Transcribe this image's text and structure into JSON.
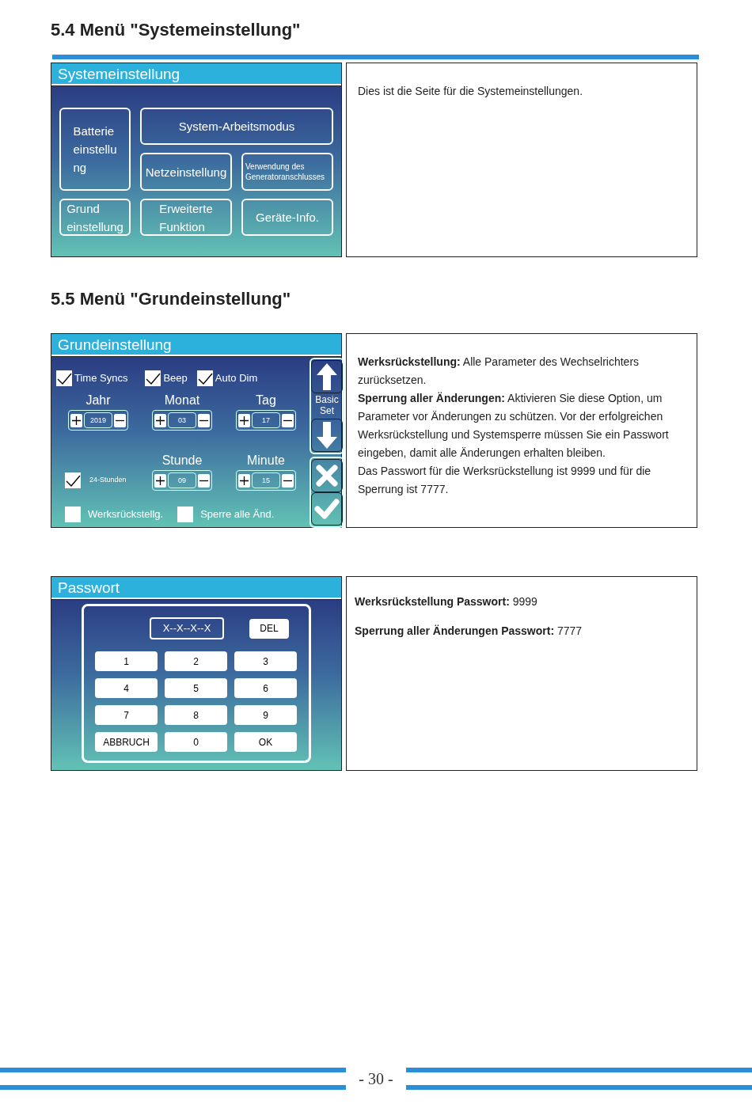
{
  "sections": [
    {
      "heading": "5.4 Menü \"Systemeinstellung\"",
      "panel": {
        "kind": "menu",
        "title": "Systemeinstellung",
        "buttons": [
          {
            "label": "Batterie\neinstellu\nng"
          },
          {
            "label": "System-Arbeitsmodus"
          },
          {
            "label": "Netzeinstellung"
          },
          {
            "label": "Verwendung des\nGeneratoranschlusses"
          },
          {
            "label": "Grund\neinstellung"
          },
          {
            "label": "Erweiterte\nFunktion"
          },
          {
            "label": "Geräte-Info."
          }
        ]
      },
      "description": [
        "Dies ist die Seite für die Systemeinstellungen."
      ]
    },
    {
      "heading": "5.5 Menü \"Grundeinstellung\"",
      "panel": {
        "kind": "basic",
        "title": "Grundeinstellung",
        "options": [
          {
            "label": "Time Syncs",
            "checked": true
          },
          {
            "label": "Beep",
            "checked": true
          },
          {
            "label": "Auto Dim",
            "checked": true
          }
        ],
        "date": [
          {
            "label": "Jahr",
            "value": "2019"
          },
          {
            "label": "Monat",
            "value": "03"
          },
          {
            "label": "Tag",
            "value": "17"
          }
        ],
        "clock_mode": {
          "label": "24-Stunden",
          "checked": true
        },
        "time": [
          {
            "label": "Stunde",
            "value": "09"
          },
          {
            "label": "Minute",
            "value": "15"
          }
        ],
        "flags": [
          {
            "label": "Werksrückstellg.",
            "checked": false
          },
          {
            "label": "Sperre alle Änd.",
            "checked": false
          }
        ],
        "side_label": "Basic Set"
      },
      "description": [
        "**Werksrückstellung:** Alle Parameter des Wechselrichters zurücksetzen.",
        "**Sperrung aller Änderungen:** Aktivieren Sie diese Option, um Parameter vor Änderungen zu schützen. Vor der erfolgreichen Werksrückstellung und Systemsperre müssen Sie ein Passwort eingeben, damit alle Änderungen erhalten bleiben.",
        "Das Passwort für die Werksrückstellung ist 9999 und für die Sperrung ist 7777."
      ]
    },
    {
      "panel": {
        "kind": "password",
        "title": "Passwort",
        "display": "X--X--X--X",
        "delete": "DEL",
        "keys": [
          "1",
          "2",
          "3",
          "4",
          "5",
          "6",
          "7",
          "8",
          "9",
          "ABBRUCH",
          "0",
          "OK"
        ]
      },
      "description": [
        "**Werksrückstellung Passwort:** 9999",
        "**Sperrung aller Änderungen Passwort:** 7777"
      ]
    }
  ],
  "page_number": "- 30 -"
}
